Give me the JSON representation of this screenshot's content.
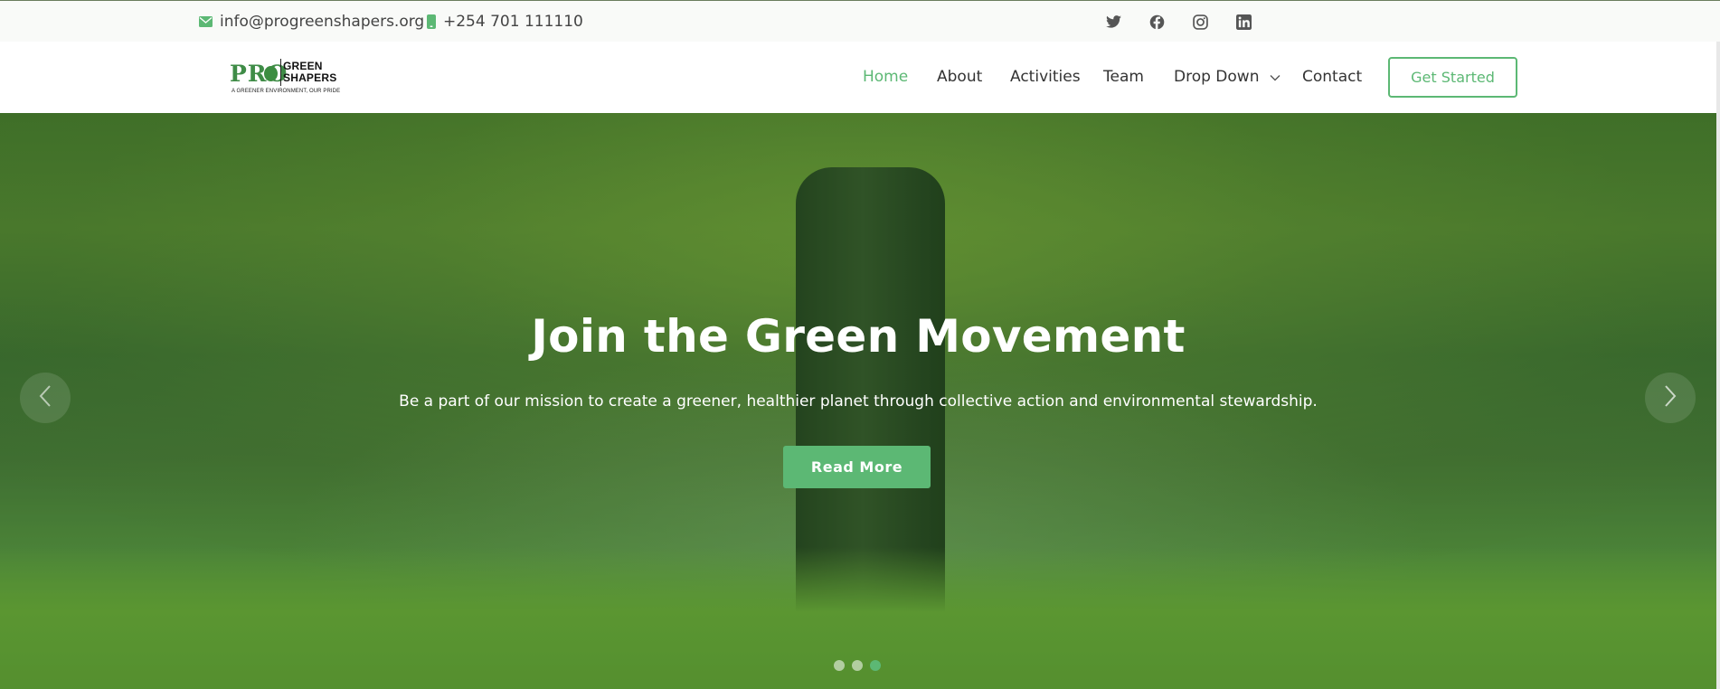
{
  "topbar": {
    "email": "info@progreenshapers.org",
    "phone": "+254 701 111110",
    "socials": [
      "twitter-icon",
      "facebook-icon",
      "instagram-icon",
      "linkedin-icon"
    ]
  },
  "logo": {
    "pro": "PRO",
    "green": "GREEN",
    "shapers": "SHAPERS",
    "tagline": "A GREENER ENVIRONMENT, OUR PRIDE"
  },
  "nav": {
    "items": [
      {
        "label": "Home",
        "active": true
      },
      {
        "label": "About"
      },
      {
        "label": "Activities"
      },
      {
        "label": "Team"
      },
      {
        "label": "Drop Down",
        "dropdown": true
      },
      {
        "label": "Contact"
      }
    ],
    "cta": "Get Started"
  },
  "hero": {
    "title": "Join the Green Movement",
    "subtitle": "Be a part of our mission to create a greener, healthier planet through collective action and environmental stewardship.",
    "button": "Read More",
    "slides": 3,
    "active_slide": 3
  },
  "colors": {
    "accent": "#5cb874",
    "text": "#333333",
    "icon": "#555555"
  }
}
